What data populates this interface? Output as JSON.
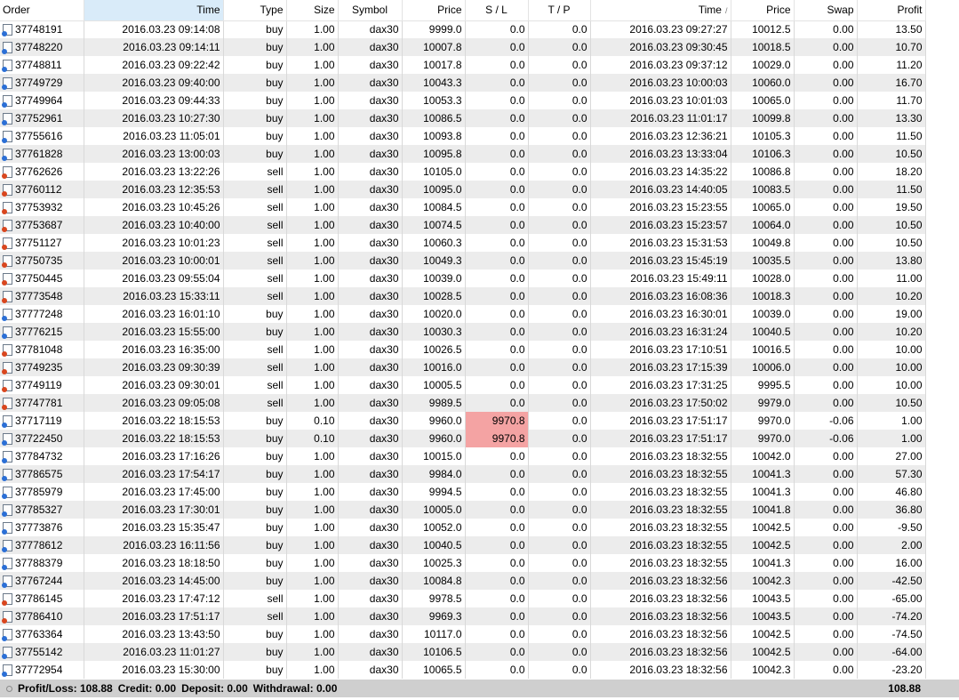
{
  "columns": {
    "order": "Order",
    "open_time": "Time",
    "type": "Type",
    "size": "Size",
    "symbol": "Symbol",
    "open_price": "Price",
    "sl": "S / L",
    "tp": "T / P",
    "close_time": "Time",
    "close_price": "Price",
    "swap": "Swap",
    "profit": "Profit"
  },
  "sort_indicator": "/",
  "rows": [
    {
      "order": "37748191",
      "open_time": "2016.03.23 09:14:08",
      "type": "buy",
      "size": "1.00",
      "symbol": "dax30",
      "open_price": "9999.0",
      "sl": "0.0",
      "tp": "0.0",
      "close_time": "2016.03.23 09:27:27",
      "close_price": "10012.5",
      "swap": "0.00",
      "profit": "13.50"
    },
    {
      "order": "37748220",
      "open_time": "2016.03.23 09:14:11",
      "type": "buy",
      "size": "1.00",
      "symbol": "dax30",
      "open_price": "10007.8",
      "sl": "0.0",
      "tp": "0.0",
      "close_time": "2016.03.23 09:30:45",
      "close_price": "10018.5",
      "swap": "0.00",
      "profit": "10.70"
    },
    {
      "order": "37748811",
      "open_time": "2016.03.23 09:22:42",
      "type": "buy",
      "size": "1.00",
      "symbol": "dax30",
      "open_price": "10017.8",
      "sl": "0.0",
      "tp": "0.0",
      "close_time": "2016.03.23 09:37:12",
      "close_price": "10029.0",
      "swap": "0.00",
      "profit": "11.20"
    },
    {
      "order": "37749729",
      "open_time": "2016.03.23 09:40:00",
      "type": "buy",
      "size": "1.00",
      "symbol": "dax30",
      "open_price": "10043.3",
      "sl": "0.0",
      "tp": "0.0",
      "close_time": "2016.03.23 10:00:03",
      "close_price": "10060.0",
      "swap": "0.00",
      "profit": "16.70"
    },
    {
      "order": "37749964",
      "open_time": "2016.03.23 09:44:33",
      "type": "buy",
      "size": "1.00",
      "symbol": "dax30",
      "open_price": "10053.3",
      "sl": "0.0",
      "tp": "0.0",
      "close_time": "2016.03.23 10:01:03",
      "close_price": "10065.0",
      "swap": "0.00",
      "profit": "11.70"
    },
    {
      "order": "37752961",
      "open_time": "2016.03.23 10:27:30",
      "type": "buy",
      "size": "1.00",
      "symbol": "dax30",
      "open_price": "10086.5",
      "sl": "0.0",
      "tp": "0.0",
      "close_time": "2016.03.23 11:01:17",
      "close_price": "10099.8",
      "swap": "0.00",
      "profit": "13.30"
    },
    {
      "order": "37755616",
      "open_time": "2016.03.23 11:05:01",
      "type": "buy",
      "size": "1.00",
      "symbol": "dax30",
      "open_price": "10093.8",
      "sl": "0.0",
      "tp": "0.0",
      "close_time": "2016.03.23 12:36:21",
      "close_price": "10105.3",
      "swap": "0.00",
      "profit": "11.50"
    },
    {
      "order": "37761828",
      "open_time": "2016.03.23 13:00:03",
      "type": "buy",
      "size": "1.00",
      "symbol": "dax30",
      "open_price": "10095.8",
      "sl": "0.0",
      "tp": "0.0",
      "close_time": "2016.03.23 13:33:04",
      "close_price": "10106.3",
      "swap": "0.00",
      "profit": "10.50"
    },
    {
      "order": "37762626",
      "open_time": "2016.03.23 13:22:26",
      "type": "sell",
      "size": "1.00",
      "symbol": "dax30",
      "open_price": "10105.0",
      "sl": "0.0",
      "tp": "0.0",
      "close_time": "2016.03.23 14:35:22",
      "close_price": "10086.8",
      "swap": "0.00",
      "profit": "18.20"
    },
    {
      "order": "37760112",
      "open_time": "2016.03.23 12:35:53",
      "type": "sell",
      "size": "1.00",
      "symbol": "dax30",
      "open_price": "10095.0",
      "sl": "0.0",
      "tp": "0.0",
      "close_time": "2016.03.23 14:40:05",
      "close_price": "10083.5",
      "swap": "0.00",
      "profit": "11.50"
    },
    {
      "order": "37753932",
      "open_time": "2016.03.23 10:45:26",
      "type": "sell",
      "size": "1.00",
      "symbol": "dax30",
      "open_price": "10084.5",
      "sl": "0.0",
      "tp": "0.0",
      "close_time": "2016.03.23 15:23:55",
      "close_price": "10065.0",
      "swap": "0.00",
      "profit": "19.50"
    },
    {
      "order": "37753687",
      "open_time": "2016.03.23 10:40:00",
      "type": "sell",
      "size": "1.00",
      "symbol": "dax30",
      "open_price": "10074.5",
      "sl": "0.0",
      "tp": "0.0",
      "close_time": "2016.03.23 15:23:57",
      "close_price": "10064.0",
      "swap": "0.00",
      "profit": "10.50"
    },
    {
      "order": "37751127",
      "open_time": "2016.03.23 10:01:23",
      "type": "sell",
      "size": "1.00",
      "symbol": "dax30",
      "open_price": "10060.3",
      "sl": "0.0",
      "tp": "0.0",
      "close_time": "2016.03.23 15:31:53",
      "close_price": "10049.8",
      "swap": "0.00",
      "profit": "10.50"
    },
    {
      "order": "37750735",
      "open_time": "2016.03.23 10:00:01",
      "type": "sell",
      "size": "1.00",
      "symbol": "dax30",
      "open_price": "10049.3",
      "sl": "0.0",
      "tp": "0.0",
      "close_time": "2016.03.23 15:45:19",
      "close_price": "10035.5",
      "swap": "0.00",
      "profit": "13.80"
    },
    {
      "order": "37750445",
      "open_time": "2016.03.23 09:55:04",
      "type": "sell",
      "size": "1.00",
      "symbol": "dax30",
      "open_price": "10039.0",
      "sl": "0.0",
      "tp": "0.0",
      "close_time": "2016.03.23 15:49:11",
      "close_price": "10028.0",
      "swap": "0.00",
      "profit": "11.00"
    },
    {
      "order": "37773548",
      "open_time": "2016.03.23 15:33:11",
      "type": "sell",
      "size": "1.00",
      "symbol": "dax30",
      "open_price": "10028.5",
      "sl": "0.0",
      "tp": "0.0",
      "close_time": "2016.03.23 16:08:36",
      "close_price": "10018.3",
      "swap": "0.00",
      "profit": "10.20"
    },
    {
      "order": "37777248",
      "open_time": "2016.03.23 16:01:10",
      "type": "buy",
      "size": "1.00",
      "symbol": "dax30",
      "open_price": "10020.0",
      "sl": "0.0",
      "tp": "0.0",
      "close_time": "2016.03.23 16:30:01",
      "close_price": "10039.0",
      "swap": "0.00",
      "profit": "19.00"
    },
    {
      "order": "37776215",
      "open_time": "2016.03.23 15:55:00",
      "type": "buy",
      "size": "1.00",
      "symbol": "dax30",
      "open_price": "10030.3",
      "sl": "0.0",
      "tp": "0.0",
      "close_time": "2016.03.23 16:31:24",
      "close_price": "10040.5",
      "swap": "0.00",
      "profit": "10.20"
    },
    {
      "order": "37781048",
      "open_time": "2016.03.23 16:35:00",
      "type": "sell",
      "size": "1.00",
      "symbol": "dax30",
      "open_price": "10026.5",
      "sl": "0.0",
      "tp": "0.0",
      "close_time": "2016.03.23 17:10:51",
      "close_price": "10016.5",
      "swap": "0.00",
      "profit": "10.00"
    },
    {
      "order": "37749235",
      "open_time": "2016.03.23 09:30:39",
      "type": "sell",
      "size": "1.00",
      "symbol": "dax30",
      "open_price": "10016.0",
      "sl": "0.0",
      "tp": "0.0",
      "close_time": "2016.03.23 17:15:39",
      "close_price": "10006.0",
      "swap": "0.00",
      "profit": "10.00"
    },
    {
      "order": "37749119",
      "open_time": "2016.03.23 09:30:01",
      "type": "sell",
      "size": "1.00",
      "symbol": "dax30",
      "open_price": "10005.5",
      "sl": "0.0",
      "tp": "0.0",
      "close_time": "2016.03.23 17:31:25",
      "close_price": "9995.5",
      "swap": "0.00",
      "profit": "10.00"
    },
    {
      "order": "37747781",
      "open_time": "2016.03.23 09:05:08",
      "type": "sell",
      "size": "1.00",
      "symbol": "dax30",
      "open_price": "9989.5",
      "sl": "0.0",
      "tp": "0.0",
      "close_time": "2016.03.23 17:50:02",
      "close_price": "9979.0",
      "swap": "0.00",
      "profit": "10.50"
    },
    {
      "order": "37717119",
      "open_time": "2016.03.22 18:15:53",
      "type": "buy",
      "size": "0.10",
      "symbol": "dax30",
      "open_price": "9960.0",
      "sl": "9970.8",
      "sl_hit": true,
      "tp": "0.0",
      "close_time": "2016.03.23 17:51:17",
      "close_price": "9970.0",
      "swap": "-0.06",
      "profit": "1.00"
    },
    {
      "order": "37722450",
      "open_time": "2016.03.22 18:15:53",
      "type": "buy",
      "size": "0.10",
      "symbol": "dax30",
      "open_price": "9960.0",
      "sl": "9970.8",
      "sl_hit": true,
      "tp": "0.0",
      "close_time": "2016.03.23 17:51:17",
      "close_price": "9970.0",
      "swap": "-0.06",
      "profit": "1.00"
    },
    {
      "order": "37784732",
      "open_time": "2016.03.23 17:16:26",
      "type": "buy",
      "size": "1.00",
      "symbol": "dax30",
      "open_price": "10015.0",
      "sl": "0.0",
      "tp": "0.0",
      "close_time": "2016.03.23 18:32:55",
      "close_price": "10042.0",
      "swap": "0.00",
      "profit": "27.00"
    },
    {
      "order": "37786575",
      "open_time": "2016.03.23 17:54:17",
      "type": "buy",
      "size": "1.00",
      "symbol": "dax30",
      "open_price": "9984.0",
      "sl": "0.0",
      "tp": "0.0",
      "close_time": "2016.03.23 18:32:55",
      "close_price": "10041.3",
      "swap": "0.00",
      "profit": "57.30"
    },
    {
      "order": "37785979",
      "open_time": "2016.03.23 17:45:00",
      "type": "buy",
      "size": "1.00",
      "symbol": "dax30",
      "open_price": "9994.5",
      "sl": "0.0",
      "tp": "0.0",
      "close_time": "2016.03.23 18:32:55",
      "close_price": "10041.3",
      "swap": "0.00",
      "profit": "46.80"
    },
    {
      "order": "37785327",
      "open_time": "2016.03.23 17:30:01",
      "type": "buy",
      "size": "1.00",
      "symbol": "dax30",
      "open_price": "10005.0",
      "sl": "0.0",
      "tp": "0.0",
      "close_time": "2016.03.23 18:32:55",
      "close_price": "10041.8",
      "swap": "0.00",
      "profit": "36.80"
    },
    {
      "order": "37773876",
      "open_time": "2016.03.23 15:35:47",
      "type": "buy",
      "size": "1.00",
      "symbol": "dax30",
      "open_price": "10052.0",
      "sl": "0.0",
      "tp": "0.0",
      "close_time": "2016.03.23 18:32:55",
      "close_price": "10042.5",
      "swap": "0.00",
      "profit": "-9.50"
    },
    {
      "order": "37778612",
      "open_time": "2016.03.23 16:11:56",
      "type": "buy",
      "size": "1.00",
      "symbol": "dax30",
      "open_price": "10040.5",
      "sl": "0.0",
      "tp": "0.0",
      "close_time": "2016.03.23 18:32:55",
      "close_price": "10042.5",
      "swap": "0.00",
      "profit": "2.00"
    },
    {
      "order": "37788379",
      "open_time": "2016.03.23 18:18:50",
      "type": "buy",
      "size": "1.00",
      "symbol": "dax30",
      "open_price": "10025.3",
      "sl": "0.0",
      "tp": "0.0",
      "close_time": "2016.03.23 18:32:55",
      "close_price": "10041.3",
      "swap": "0.00",
      "profit": "16.00"
    },
    {
      "order": "37767244",
      "open_time": "2016.03.23 14:45:00",
      "type": "buy",
      "size": "1.00",
      "symbol": "dax30",
      "open_price": "10084.8",
      "sl": "0.0",
      "tp": "0.0",
      "close_time": "2016.03.23 18:32:56",
      "close_price": "10042.3",
      "swap": "0.00",
      "profit": "-42.50"
    },
    {
      "order": "37786145",
      "open_time": "2016.03.23 17:47:12",
      "type": "sell",
      "size": "1.00",
      "symbol": "dax30",
      "open_price": "9978.5",
      "sl": "0.0",
      "tp": "0.0",
      "close_time": "2016.03.23 18:32:56",
      "close_price": "10043.5",
      "swap": "0.00",
      "profit": "-65.00"
    },
    {
      "order": "37786410",
      "open_time": "2016.03.23 17:51:17",
      "type": "sell",
      "size": "1.00",
      "symbol": "dax30",
      "open_price": "9969.3",
      "sl": "0.0",
      "tp": "0.0",
      "close_time": "2016.03.23 18:32:56",
      "close_price": "10043.5",
      "swap": "0.00",
      "profit": "-74.20"
    },
    {
      "order": "37763364",
      "open_time": "2016.03.23 13:43:50",
      "type": "buy",
      "size": "1.00",
      "symbol": "dax30",
      "open_price": "10117.0",
      "sl": "0.0",
      "tp": "0.0",
      "close_time": "2016.03.23 18:32:56",
      "close_price": "10042.5",
      "swap": "0.00",
      "profit": "-74.50"
    },
    {
      "order": "37755142",
      "open_time": "2016.03.23 11:01:27",
      "type": "buy",
      "size": "1.00",
      "symbol": "dax30",
      "open_price": "10106.5",
      "sl": "0.0",
      "tp": "0.0",
      "close_time": "2016.03.23 18:32:56",
      "close_price": "10042.5",
      "swap": "0.00",
      "profit": "-64.00"
    },
    {
      "order": "37772954",
      "open_time": "2016.03.23 15:30:00",
      "type": "buy",
      "size": "1.00",
      "symbol": "dax30",
      "open_price": "10065.5",
      "sl": "0.0",
      "tp": "0.0",
      "close_time": "2016.03.23 18:32:56",
      "close_price": "10042.3",
      "swap": "0.00",
      "profit": "-23.20"
    }
  ],
  "summary": {
    "profit_loss": "Profit/Loss: 108.88",
    "credit": "Credit: 0.00",
    "deposit": "Deposit: 0.00",
    "withdrawal": "Withdrawal: 0.00",
    "total": "108.88"
  },
  "colors": {
    "sorted_header": "#d9ebf9",
    "row_alt": "#ececec",
    "sl_highlight": "#f4a3a3",
    "summary_bar": "#cfcfcf",
    "buy_icon": "#2b6fd6",
    "sell_icon": "#d9461e"
  },
  "icons": {
    "buy": "buy-order-icon",
    "sell": "sell-order-icon",
    "summary": "summary-circle-icon"
  }
}
